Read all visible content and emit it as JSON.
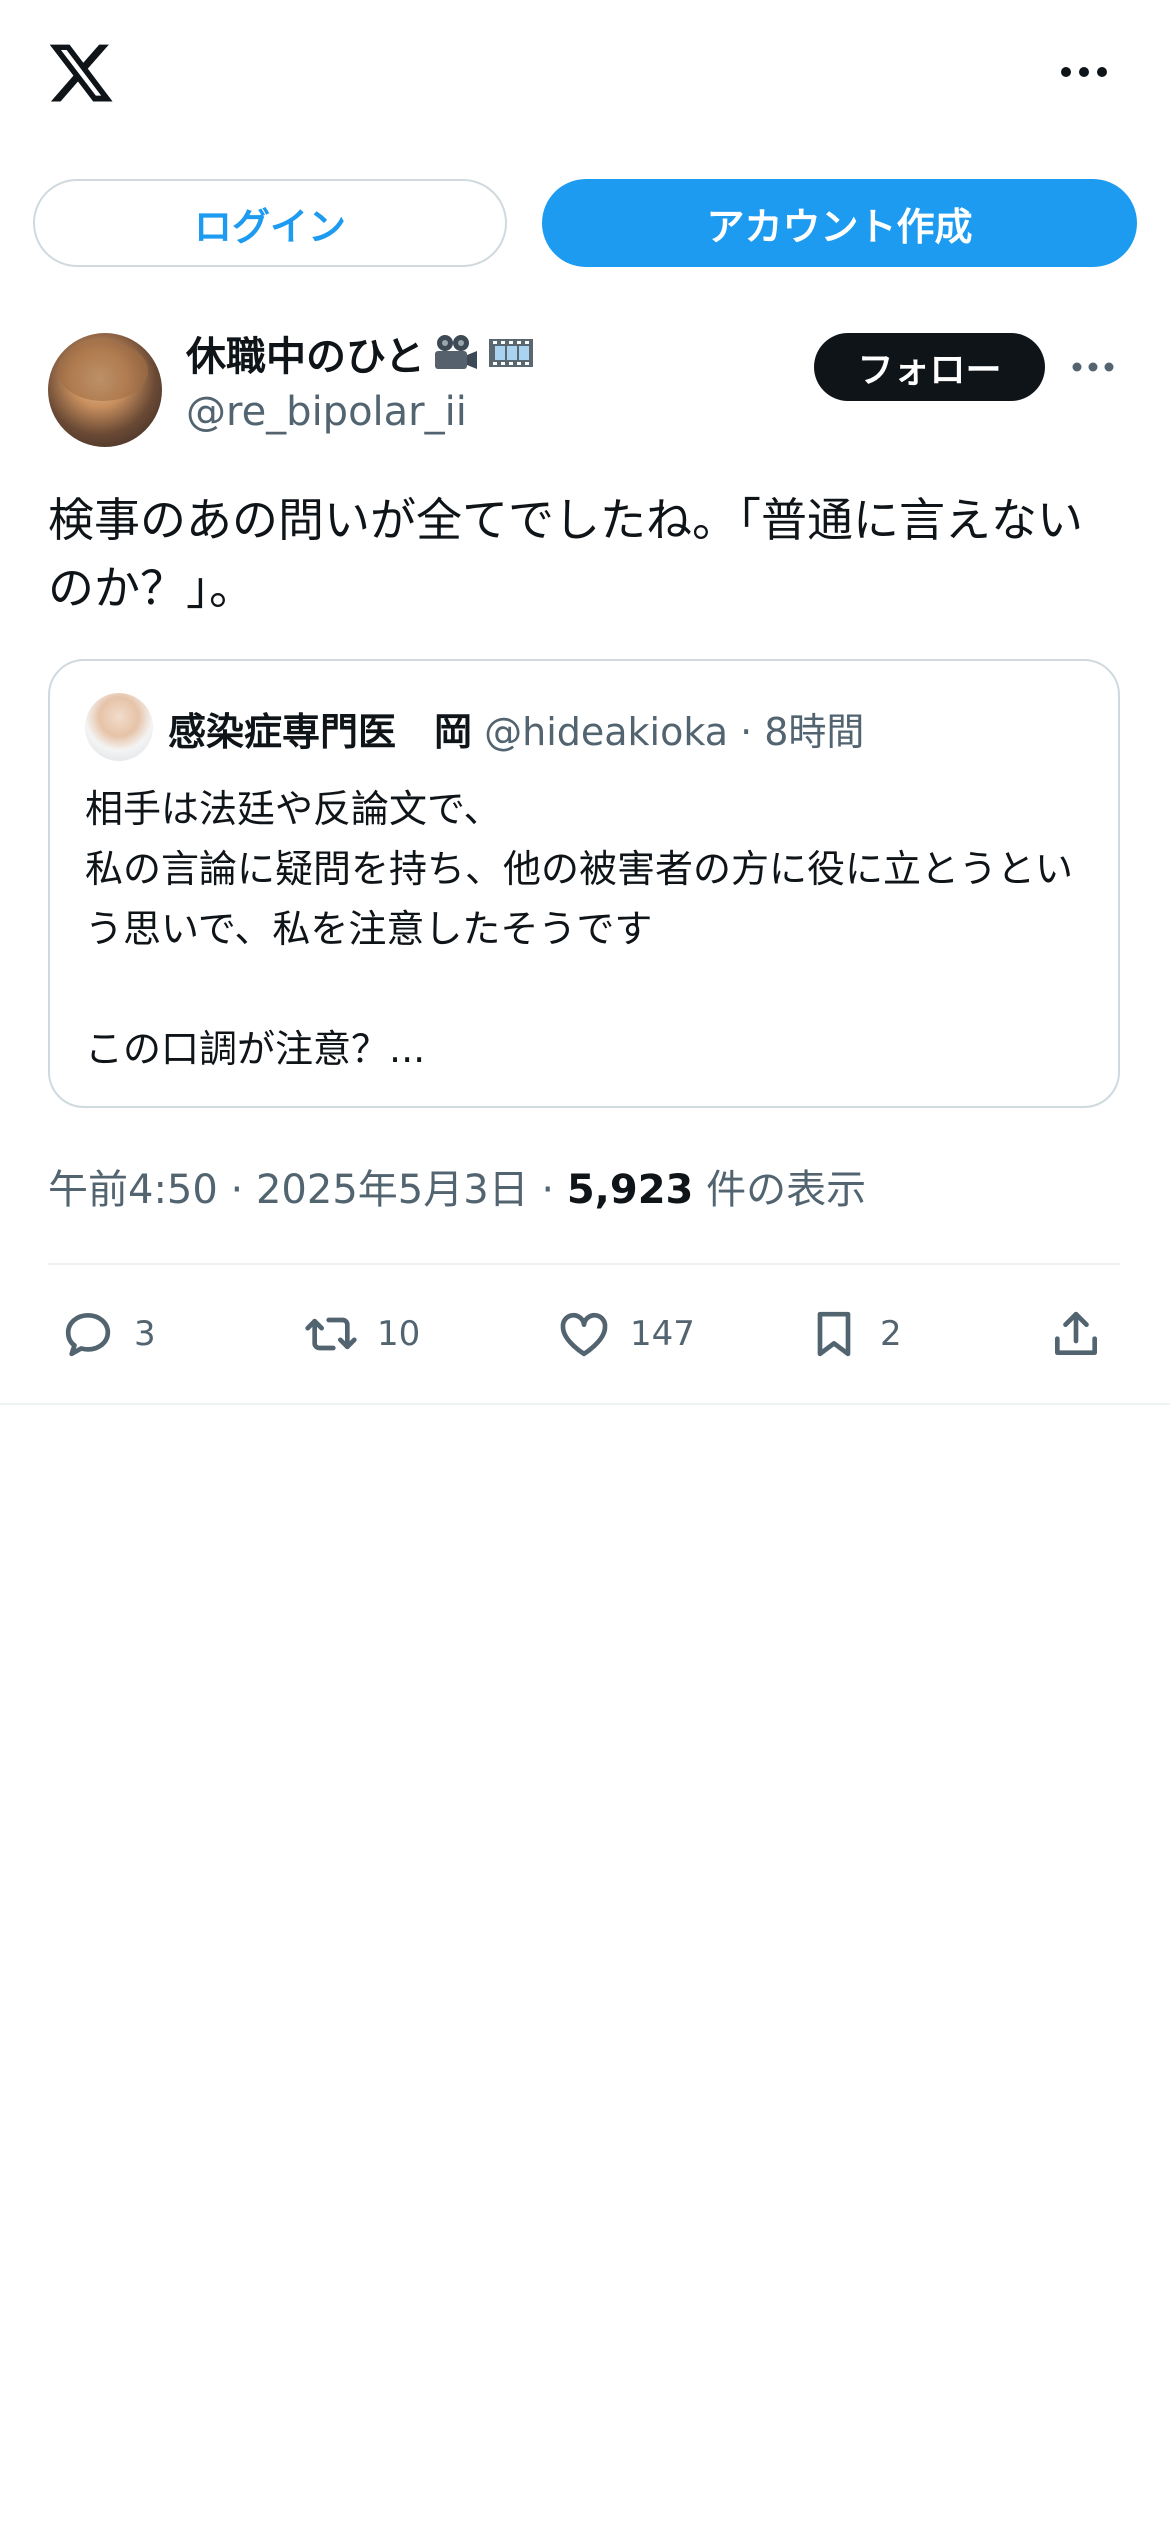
{
  "top_bar": {
    "logo_icon": "x-logo-icon",
    "more_icon": "more-horizontal-icon"
  },
  "auth": {
    "login_label": "ログイン",
    "signup_label": "アカウント作成"
  },
  "author": {
    "name": "休職中のひと",
    "name_emojis": [
      "movie-camera-icon",
      "film-frames-icon"
    ],
    "handle": "@re_bipolar_ii",
    "follow_label": "フォロー"
  },
  "tweet": {
    "text": "検事のあの問いが全てでしたね。「普通に言えないのか？」。"
  },
  "quote": {
    "name": "感染症専門医　岡",
    "handle": "@hideakioka",
    "separator": " · ",
    "time": "8時間",
    "text": "相手は法廷や反論文で、\n私の言論に疑問を持ち、他の被害者の方に役に立とうという思いで、私を注意したそうです\n\nこの口調が注意？..."
  },
  "meta": {
    "time": "午前4:50",
    "sep1": " · ",
    "date": "2025年5月3日",
    "sep2": " · ",
    "views": "5,923",
    "views_label": " 件の表示"
  },
  "actions": {
    "reply_count": "3",
    "retweet_count": "10",
    "like_count": "147",
    "bookmark_count": "2"
  },
  "colors": {
    "accent": "#1d9bf0",
    "text": "#0f1419",
    "secondary": "#536471",
    "border": "#cfd9de"
  }
}
